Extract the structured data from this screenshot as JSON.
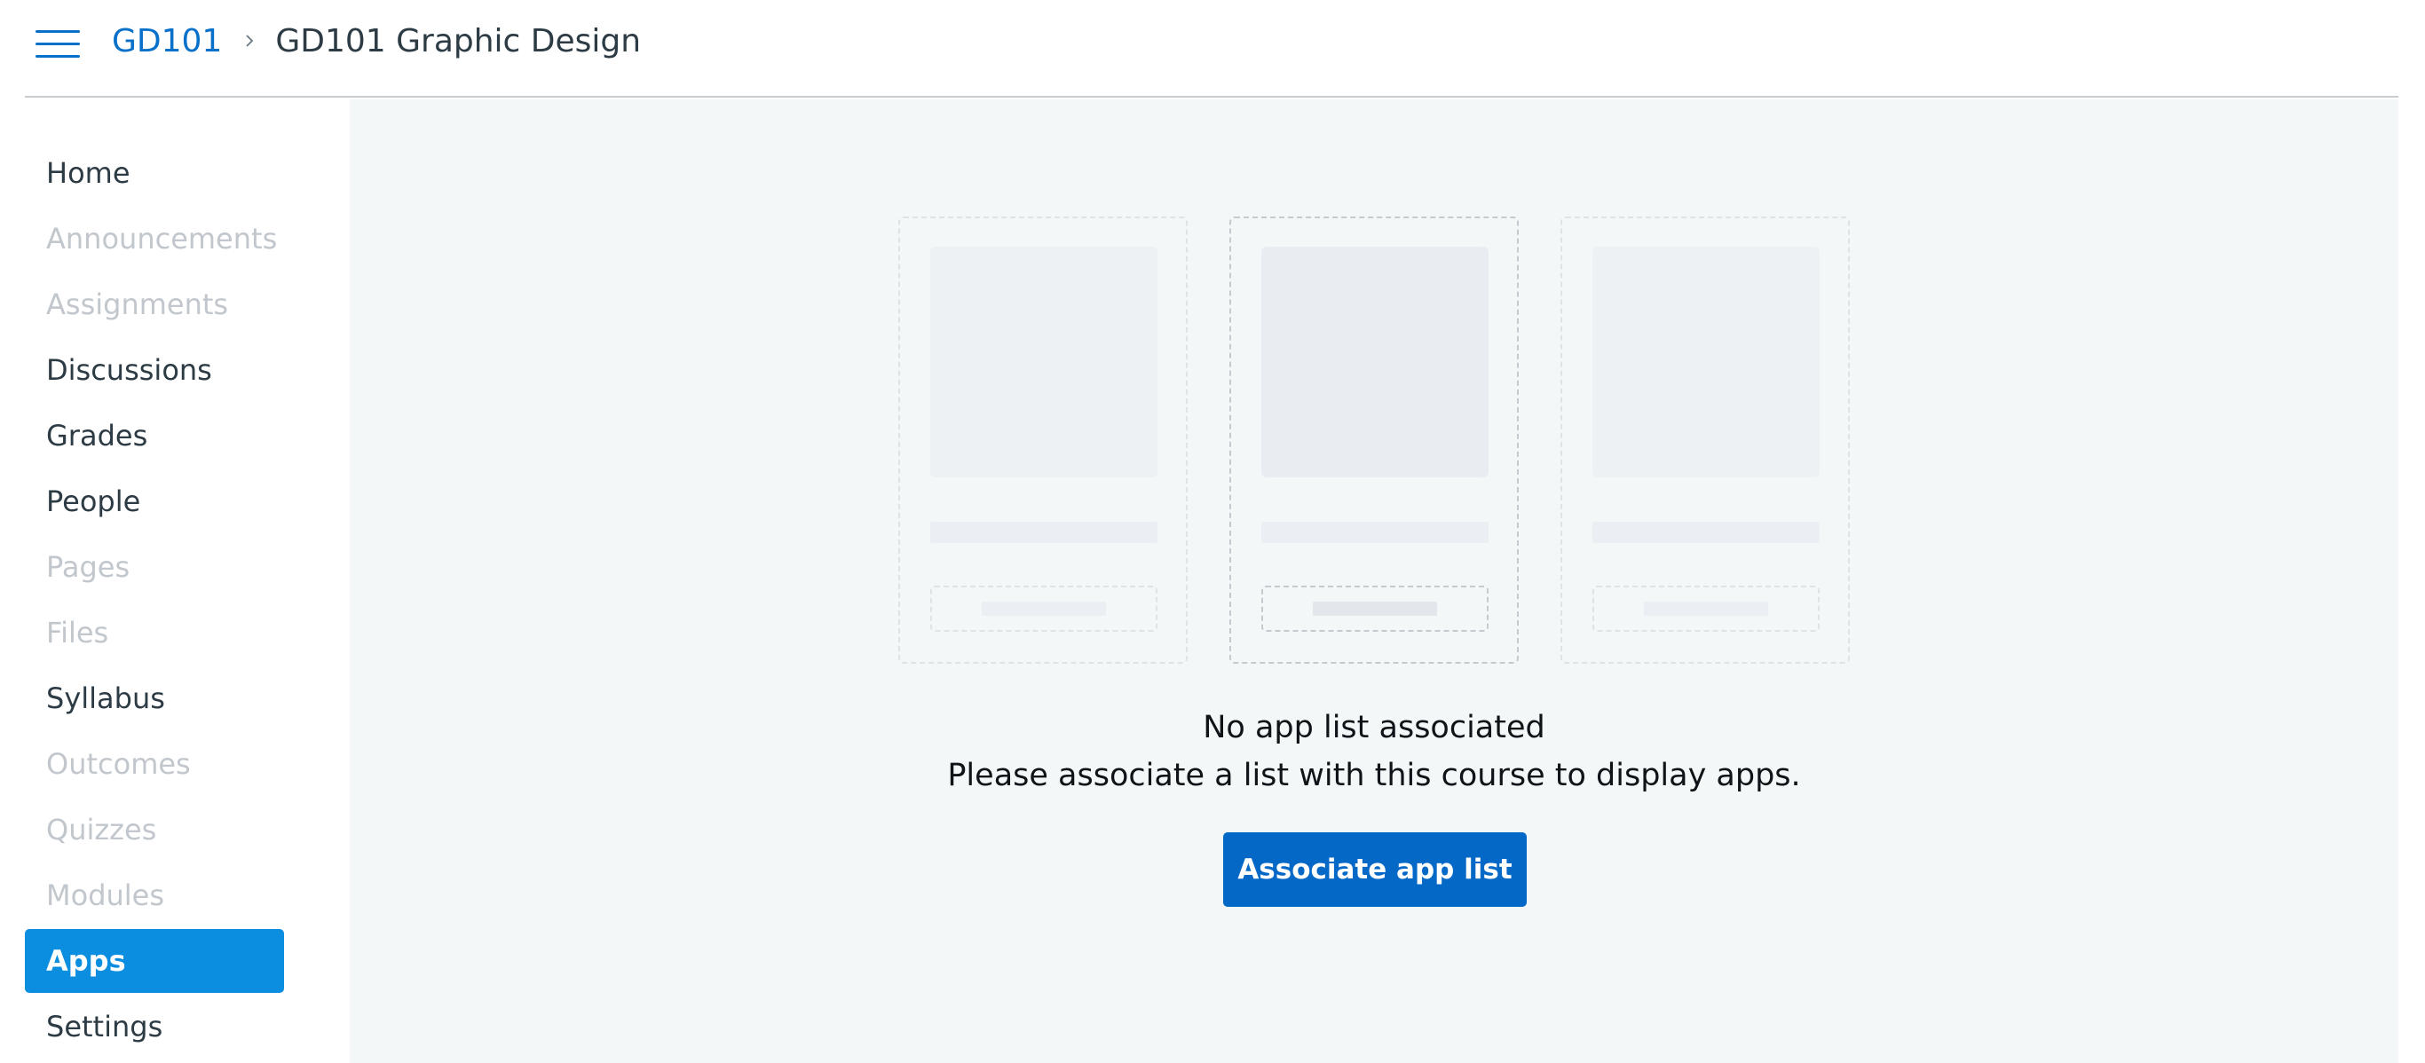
{
  "header": {
    "menu_icon": "hamburger-menu-icon",
    "breadcrumb": {
      "course_code": "GD101",
      "separator_icon": "chevron-right-icon",
      "course_name": "GD101 Graphic Design"
    }
  },
  "sidebar": {
    "items": [
      {
        "label": "Home",
        "state": "enabled"
      },
      {
        "label": "Announcements",
        "state": "disabled"
      },
      {
        "label": "Assignments",
        "state": "disabled"
      },
      {
        "label": "Discussions",
        "state": "enabled"
      },
      {
        "label": "Grades",
        "state": "enabled"
      },
      {
        "label": "People",
        "state": "enabled"
      },
      {
        "label": "Pages",
        "state": "disabled"
      },
      {
        "label": "Files",
        "state": "disabled"
      },
      {
        "label": "Syllabus",
        "state": "enabled"
      },
      {
        "label": "Outcomes",
        "state": "disabled"
      },
      {
        "label": "Quizzes",
        "state": "disabled"
      },
      {
        "label": "Modules",
        "state": "disabled"
      },
      {
        "label": "Apps",
        "state": "active"
      },
      {
        "label": "Settings",
        "state": "enabled"
      }
    ]
  },
  "main": {
    "empty_state": {
      "title": "No app list associated",
      "description": "Please associate a list with this course to display apps.",
      "button_label": "Associate app list"
    }
  },
  "colors": {
    "link": "#0770c8",
    "active_nav": "#0b8ee0",
    "primary_button": "#0468c7",
    "main_background": "#f4f7f8",
    "disabled_text": "#c1c7cc"
  }
}
